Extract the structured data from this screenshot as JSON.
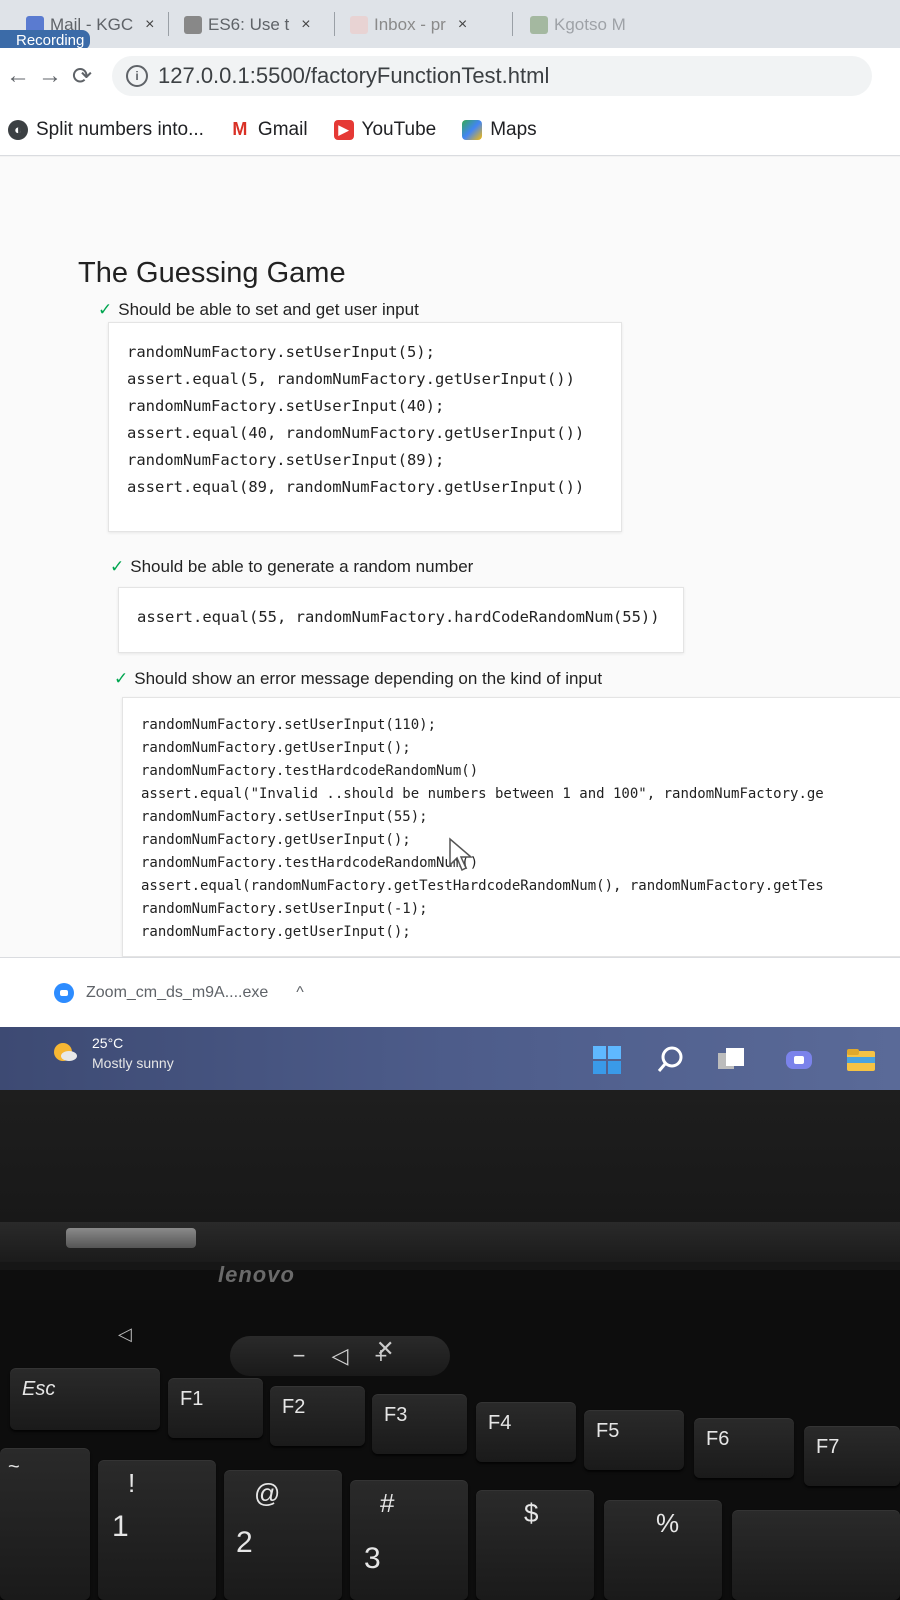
{
  "browser": {
    "tabs": [
      {
        "label": "Mail - KGC",
        "close": "×"
      },
      {
        "label": "ES6: Use t",
        "close": "×"
      },
      {
        "label": "Inbox - pr",
        "close": "×"
      },
      {
        "label": "Kgotso M"
      }
    ],
    "recording_label": "Recording",
    "url": "127.0.0.1:5500/factoryFunctionTest.html",
    "bookmarks": [
      {
        "label": "Split numbers into..."
      },
      {
        "label": "Gmail"
      },
      {
        "label": "YouTube"
      },
      {
        "label": "Maps"
      }
    ]
  },
  "page": {
    "suite_title": "The Guessing Game",
    "tests": [
      {
        "title": "Should be able to set and get user input",
        "code": [
          "randomNumFactory.setUserInput(5);",
          "assert.equal(5, randomNumFactory.getUserInput())",
          "randomNumFactory.setUserInput(40);",
          "assert.equal(40, randomNumFactory.getUserInput())",
          "randomNumFactory.setUserInput(89);",
          "assert.equal(89, randomNumFactory.getUserInput())"
        ]
      },
      {
        "title": "Should be able to generate a random number",
        "code": [
          "assert.equal(55, randomNumFactory.hardCodeRandomNum(55))"
        ]
      },
      {
        "title": "Should show an error message depending on the kind of input",
        "code": [
          "randomNumFactory.setUserInput(110);",
          "randomNumFactory.getUserInput();",
          "randomNumFactory.testHardcodeRandomNum()",
          "assert.equal(\"Invalid ..should be numbers between 1 and 100\", randomNumFactory.ge",
          "randomNumFactory.setUserInput(55);",
          "randomNumFactory.getUserInput();",
          "randomNumFactory.testHardcodeRandomNum()",
          "assert.equal(randomNumFactory.getTestHardcodeRandomNum(), randomNumFactory.getTes",
          "randomNumFactory.setUserInput(-1);",
          "randomNumFactory.getUserInput();"
        ]
      }
    ],
    "check_glyph": "✓"
  },
  "download": {
    "filename": "Zoom_cm_ds_m9A....exe",
    "chevron": "^"
  },
  "taskbar": {
    "temperature": "25°C",
    "weather": "Mostly sunny"
  },
  "laptop": {
    "brand": "lenovo",
    "keys": {
      "esc": "Esc",
      "f1": "F1",
      "f2": "F2",
      "f3": "F3",
      "f4": "F4",
      "f5": "F5",
      "f6": "F6",
      "f7": "F7",
      "k1_top": "!",
      "k1": "1",
      "k2_top": "@",
      "k2": "2",
      "k3_top": "#",
      "k3": "3",
      "k4_top": "$",
      "k5_top": "%",
      "tilde": "~"
    },
    "media_keys": {
      "minus": "−",
      "plus": "+"
    }
  },
  "colors": {
    "check_green": "#00a650",
    "taskbar": "#4d5c8a",
    "recording_badge": "#3b6ba8"
  }
}
